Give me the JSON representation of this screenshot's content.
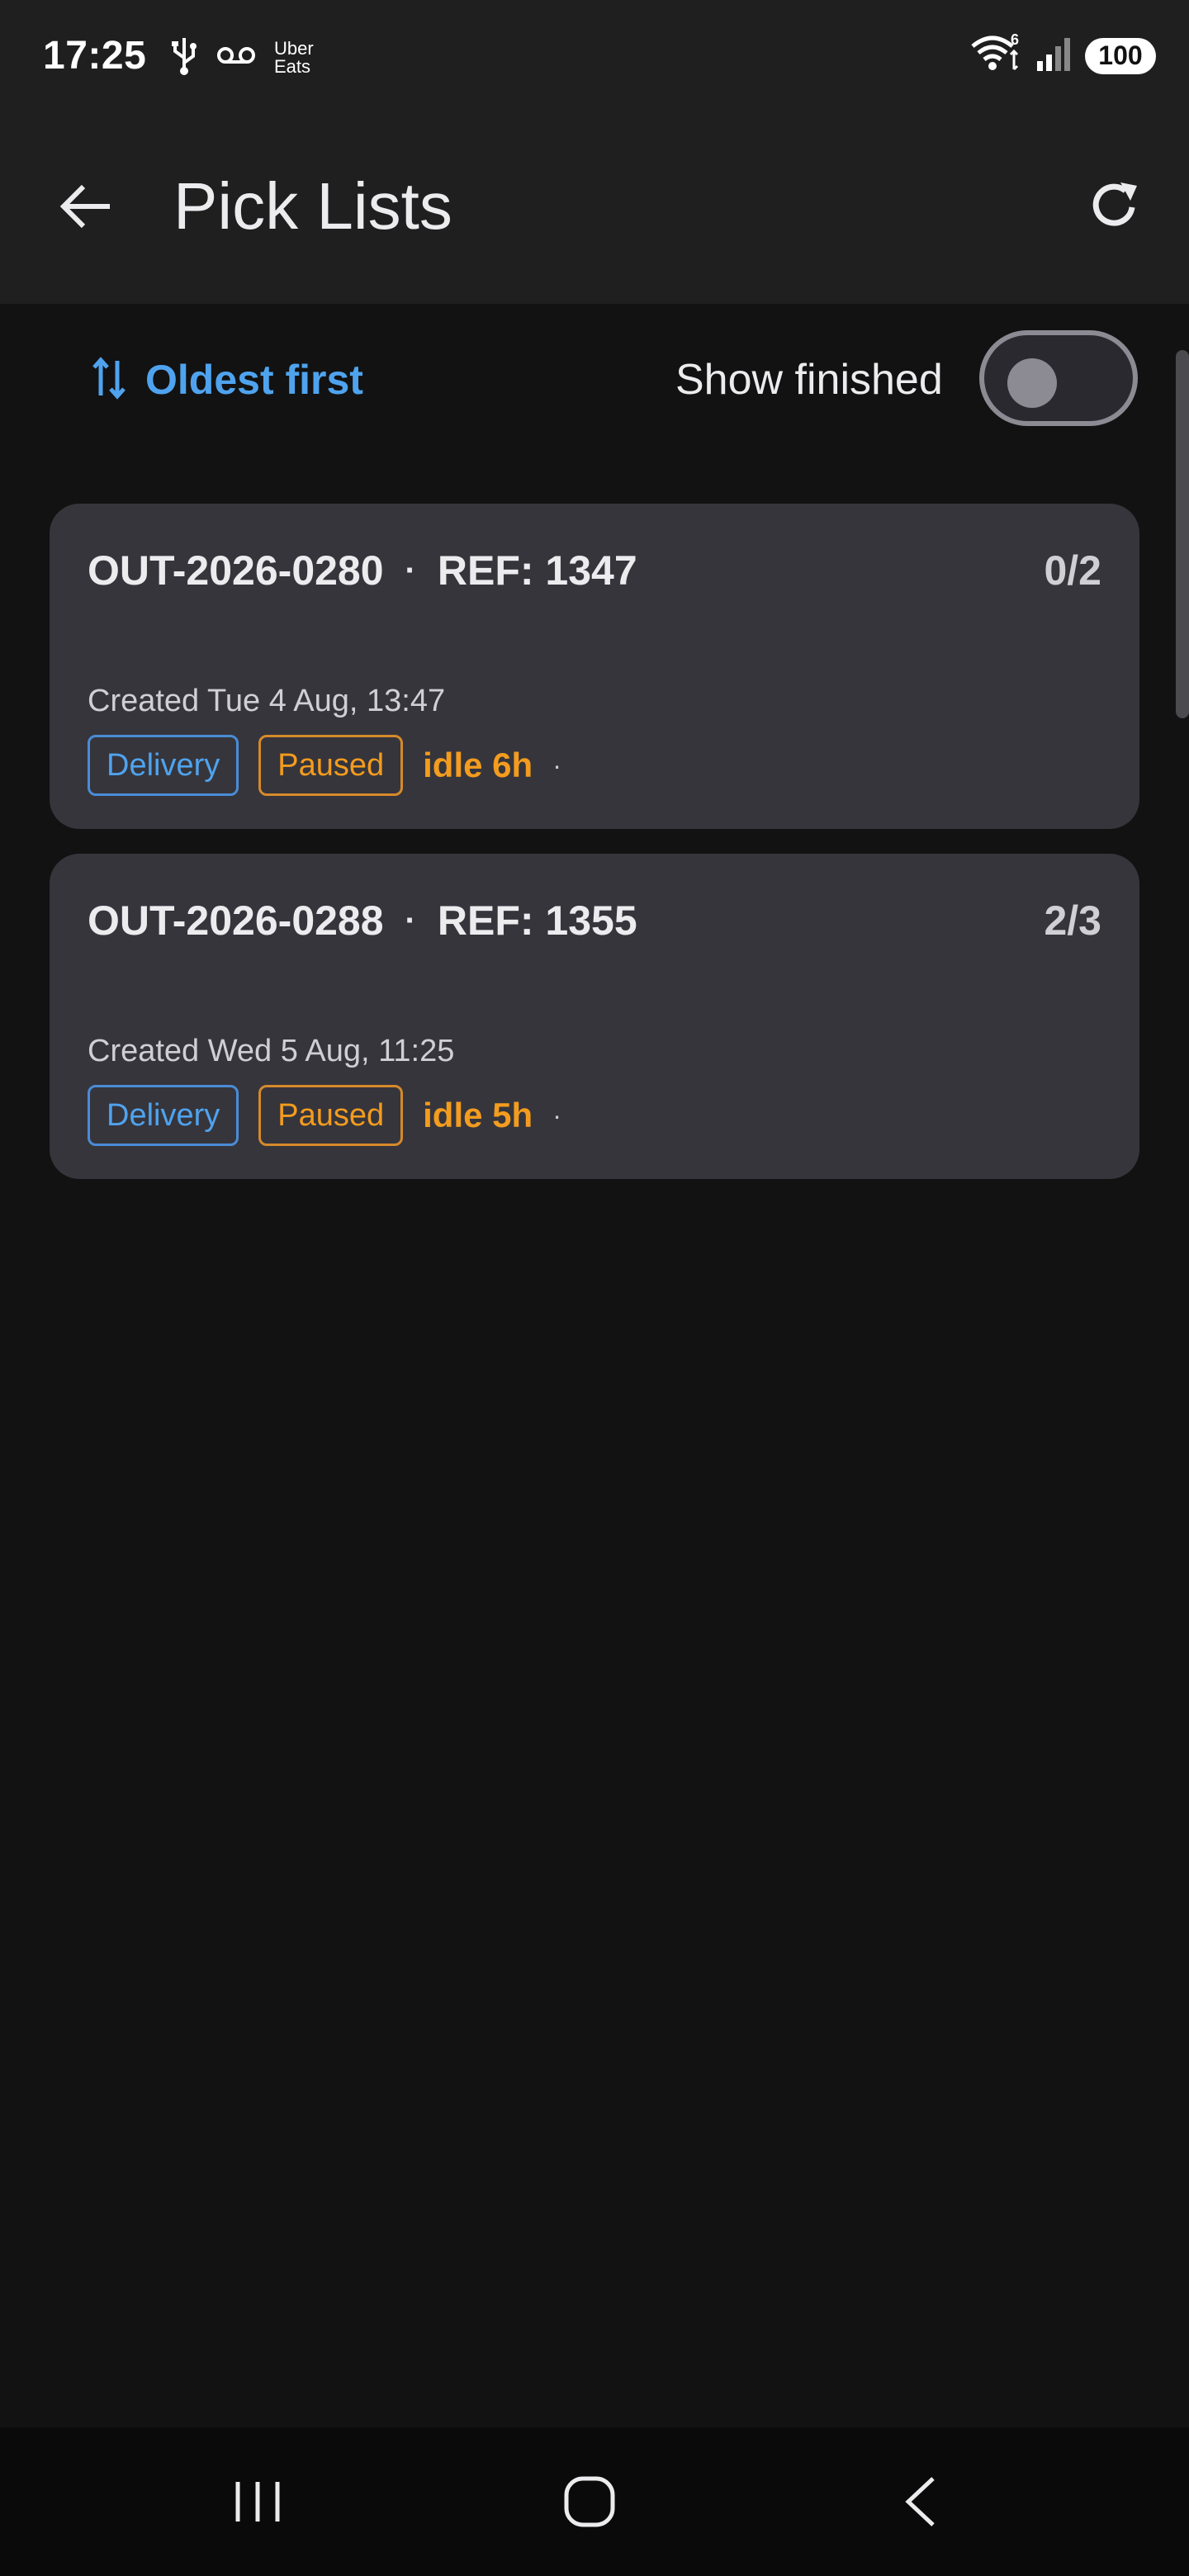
{
  "status_bar": {
    "time": "17:25",
    "notification_app_line1": "Uber",
    "notification_app_line2": "Eats",
    "battery": "100",
    "wifi_badge": "6"
  },
  "app_bar": {
    "title": "Pick Lists"
  },
  "filters": {
    "sort_label": "Oldest first",
    "show_finished_label": "Show finished",
    "show_finished_on": false
  },
  "pick_lists": [
    {
      "order_id": "OUT-2026-0280",
      "separator": "·",
      "ref": "REF: 1347",
      "progress": "0/2",
      "created": "Created Tue 4 Aug, 13:47",
      "type_tag": "Delivery",
      "status_tag": "Paused",
      "idle": "idle 6h",
      "trailing": "·"
    },
    {
      "order_id": "OUT-2026-0288",
      "separator": "·",
      "ref": "REF: 1355",
      "progress": "2/3",
      "created": "Created Wed 5 Aug, 11:25",
      "type_tag": "Delivery",
      "status_tag": "Paused",
      "idle": "idle 5h",
      "trailing": "·"
    }
  ],
  "colors": {
    "accent_blue": "#4fa3ee",
    "accent_orange": "#f39c1e",
    "card_bg": "#36353c",
    "page_bg": "#121212"
  }
}
